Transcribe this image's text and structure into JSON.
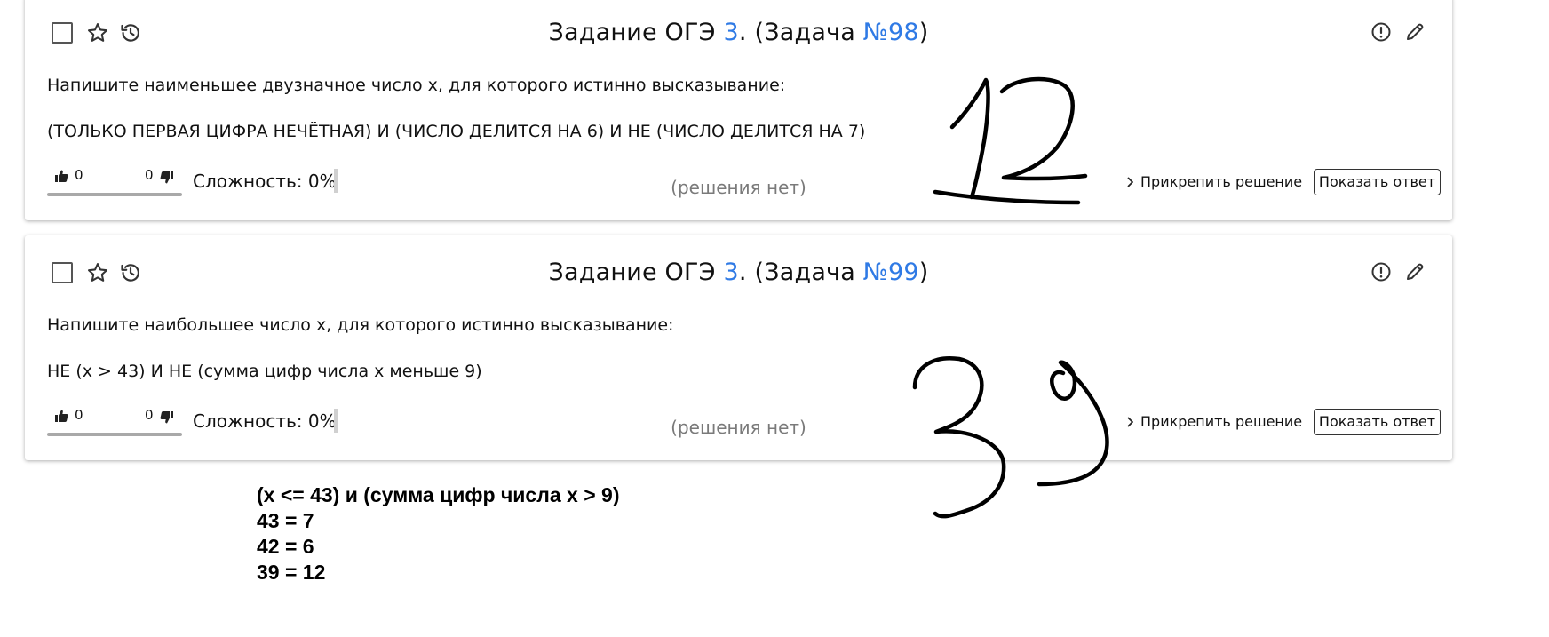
{
  "tasks": [
    {
      "title_prefix": "Задание ОГЭ ",
      "task_number": "3",
      "title_middle": ". (Задача ",
      "problem_id": "№98",
      "title_suffix": ")",
      "statement": "Напишите наименьшее двузначное число x, для которого истинно высказывание:",
      "condition": "(ТОЛЬКО ПЕРВАЯ ЦИФРА НЕЧЁТНАЯ) И (ЧИСЛО ДЕЛИТСЯ НА 6) И НЕ (ЧИСЛО ДЕЛИТСЯ НА 7)",
      "likes": "0",
      "dislikes": "0",
      "difficulty": "Сложность: 0%",
      "solutions_status": "(решения нет)",
      "attach_solution": "Прикрепить решение",
      "show_answer": "Показать ответ",
      "handwritten_answer": "12"
    },
    {
      "title_prefix": "Задание ОГЭ ",
      "task_number": "3",
      "title_middle": ". (Задача ",
      "problem_id": "№99",
      "title_suffix": ")",
      "statement": "Напишите наибольшее число x, для которого истинно высказывание:",
      "condition": "НЕ (x > 43) И НЕ (сумма цифр числа x меньше 9)",
      "likes": "0",
      "dislikes": "0",
      "difficulty": "Сложность: 0%",
      "solutions_status": "(решения нет)",
      "attach_solution": "Прикрепить решение",
      "show_answer": "Показать ответ",
      "handwritten_answer": "39"
    }
  ],
  "icons": {
    "checkbox": "checkbox-icon",
    "favorite": "star-icon",
    "history": "history-icon",
    "report": "exclamation-circle-icon",
    "edit": "pencil-icon",
    "like": "thumbs-up-icon",
    "dislike": "thumbs-down-icon",
    "expand": "chevron-right-icon"
  },
  "colors": {
    "link": "#2f7ae5",
    "muted_text": "#7a7a7a",
    "vote_bar": "#a9a9a9"
  },
  "notes": {
    "lines": [
      "(x <= 43) и (сумма цифр числа x > 9)",
      "43 = 7",
      "42 = 6",
      "39 = 12"
    ]
  }
}
